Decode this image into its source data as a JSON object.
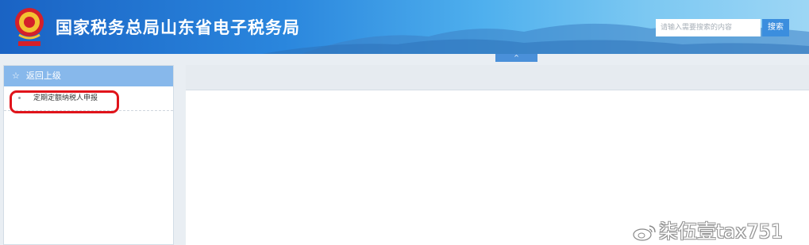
{
  "header": {
    "title": "国家税务总局山东省电子税务局",
    "search_placeholder": "请输入需要搜索的内容",
    "search_button": "搜索",
    "emblem_icon": "tax-emblem-icon"
  },
  "collapse_tab": {
    "label": "^"
  },
  "sidebar": {
    "back_label": "返回上级",
    "back_icon": "star-icon",
    "items": [
      {
        "label": "定期定额纳税人申报"
      }
    ]
  },
  "watermark": {
    "text": "柒伍壹tax751",
    "icon": "weibo-icon"
  },
  "colors": {
    "header_dark": "#1a63c4",
    "header_light": "#9dd6f5",
    "sidebar_head": "#87b8eb",
    "highlight": "#e0141b"
  }
}
